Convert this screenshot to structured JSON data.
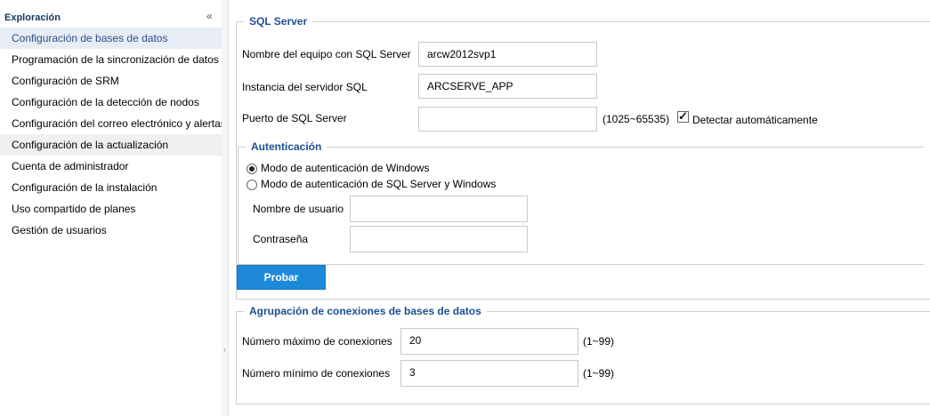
{
  "sidebar": {
    "title": "Exploración",
    "collapse_icon": "double-chevron-left-icon",
    "items": [
      {
        "label": "Configuración de bases de datos",
        "state": "active"
      },
      {
        "label": "Programación de la sincronización de datos",
        "state": "normal"
      },
      {
        "label": "Configuración de SRM",
        "state": "normal"
      },
      {
        "label": "Configuración de la detección de nodos",
        "state": "normal"
      },
      {
        "label": "Configuración del correo electrónico y alertas",
        "state": "normal"
      },
      {
        "label": "Configuración de la actualización",
        "state": "hover"
      },
      {
        "label": "Cuenta de administrador",
        "state": "normal"
      },
      {
        "label": "Configuración de la instalación",
        "state": "normal"
      },
      {
        "label": "Uso compartido de planes",
        "state": "normal"
      },
      {
        "label": "Gestión de usuarios",
        "state": "normal"
      }
    ]
  },
  "sql_server": {
    "legend": "SQL Server",
    "machine_label": "Nombre del equipo con SQL Server",
    "machine_value": "arcw2012svp1",
    "instance_label": "Instancia del servidor SQL",
    "instance_value": "ARCSERVE_APP",
    "port_label": "Puerto de SQL Server",
    "port_value": "",
    "port_range": "(1025~65535)",
    "auto_detect_label": "Detectar automáticamente",
    "auto_detect_checked": true
  },
  "auth": {
    "legend": "Autenticación",
    "windows_mode_label": "Modo de autenticación de Windows",
    "sql_windows_mode_label": "Modo de autenticación de SQL Server y Windows",
    "selected": "windows",
    "username_label": "Nombre de usuario",
    "username_value": "",
    "password_label": "Contraseña",
    "password_value": ""
  },
  "test_button_label": "Probar",
  "pool": {
    "legend": "Agrupación de conexiones de bases de datos",
    "max_label": "Número máximo de conexiones",
    "max_value": "20",
    "max_range": "(1~99)",
    "min_label": "Número mínimo de conexiones",
    "min_value": "3",
    "min_range": "(1~99)"
  },
  "colors": {
    "accent": "#1d8ad9",
    "legend": "#1d4f91",
    "active_nav_bg": "#e7ecf5"
  }
}
